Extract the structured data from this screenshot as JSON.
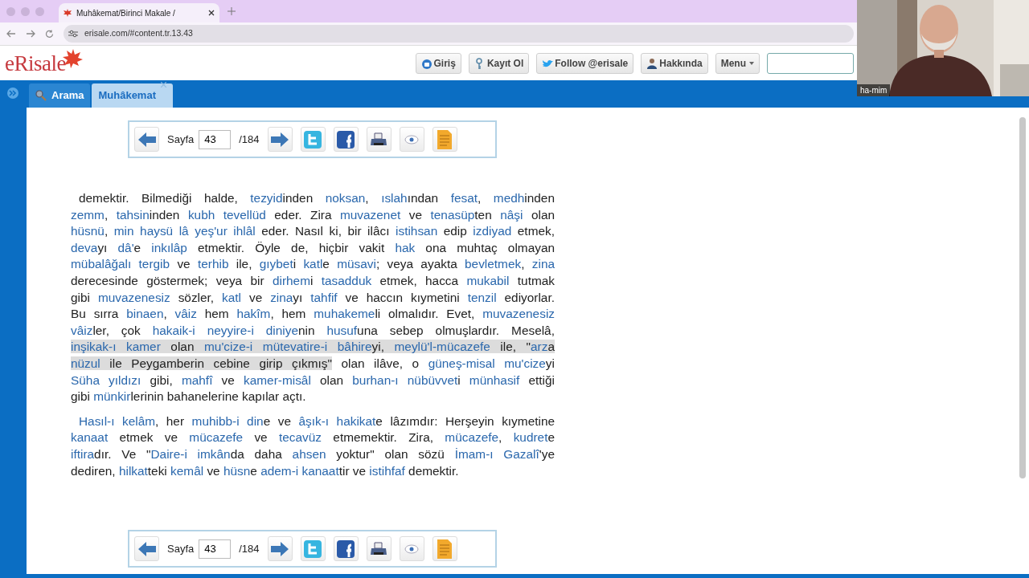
{
  "browser": {
    "tab_title": "Muhâkemat/Birinci Makale /",
    "url": "erisale.com/#content.tr.13.43"
  },
  "header": {
    "logo": "eRisale",
    "buttons": [
      {
        "label": "Giriş",
        "kind": "lock"
      },
      {
        "label": "Kayıt Ol",
        "kind": "key"
      },
      {
        "label": "Follow @erisale",
        "kind": "bird"
      },
      {
        "label": "Hakkında",
        "kind": "person"
      },
      {
        "label": "Menu",
        "kind": "menu"
      }
    ]
  },
  "tabs": [
    {
      "label": "Arama",
      "selected": false
    },
    {
      "label": "Muhâkemat",
      "selected": true
    }
  ],
  "pagers": [
    {
      "label": "Sayfa",
      "page": "43",
      "total": "/184"
    },
    {
      "label": "Sayfa",
      "page": "43",
      "total": "/184"
    }
  ],
  "paragraphs": [
    {
      "lines": [
        [
          {
            "text": "demektir. Bilmediği halde, ",
            "kind": "plain"
          },
          {
            "text": "tezyid",
            "kind": "link"
          },
          {
            "text": "inden ",
            "kind": "plain"
          },
          {
            "text": "noksan",
            "kind": "link"
          },
          {
            "text": ", ",
            "kind": "plain"
          },
          {
            "text": "ıslah",
            "kind": "link"
          },
          {
            "text": "ından ",
            "kind": "plain"
          },
          {
            "text": "fesat",
            "kind": "link"
          },
          {
            "text": ", ",
            "kind": "plain"
          },
          {
            "text": "medh",
            "kind": "link"
          },
          {
            "text": "inden",
            "kind": "plain"
          }
        ],
        [
          {
            "text": "zemm",
            "kind": "link"
          },
          {
            "text": ", ",
            "kind": "plain"
          },
          {
            "text": "tahsin",
            "kind": "link"
          },
          {
            "text": "inden ",
            "kind": "plain"
          },
          {
            "text": "kubh tevellüd",
            "kind": "link"
          },
          {
            "text": " eder. Zira ",
            "kind": "plain"
          },
          {
            "text": "muvazenet",
            "kind": "link"
          },
          {
            "text": " ve ",
            "kind": "plain"
          },
          {
            "text": "tenasüp",
            "kind": "link"
          },
          {
            "text": "ten ",
            "kind": "plain"
          },
          {
            "text": "nâşi",
            "kind": "link"
          },
          {
            "text": " olan",
            "kind": "plain"
          }
        ],
        [
          {
            "text": "hüsnü",
            "kind": "link"
          },
          {
            "text": ", ",
            "kind": "plain"
          },
          {
            "text": "min haysü lâ yeş'ur ihlâl",
            "kind": "link"
          },
          {
            "text": " eder. Nasıl ki, bir ilâcı ",
            "kind": "plain"
          },
          {
            "text": "istihsan",
            "kind": "link"
          },
          {
            "text": " edip ",
            "kind": "plain"
          },
          {
            "text": "izdiyad",
            "kind": "link"
          },
          {
            "text": " etmek,",
            "kind": "plain"
          }
        ],
        [
          {
            "text": "deva",
            "kind": "link"
          },
          {
            "text": "yı ",
            "kind": "plain"
          },
          {
            "text": "dâ'",
            "kind": "link"
          },
          {
            "text": "e ",
            "kind": "plain"
          },
          {
            "text": "inkılâp",
            "kind": "link"
          },
          {
            "text": " etmektir. Öyle de, hiçbir vakit ",
            "kind": "plain"
          },
          {
            "text": "hak",
            "kind": "link"
          },
          {
            "text": " ona muhtaç olmayan",
            "kind": "plain"
          }
        ],
        [
          {
            "text": "mübalâğalı tergib",
            "kind": "link"
          },
          {
            "text": " ve ",
            "kind": "plain"
          },
          {
            "text": "terhib",
            "kind": "link"
          },
          {
            "text": " ile, ",
            "kind": "plain"
          },
          {
            "text": "gıybet",
            "kind": "link"
          },
          {
            "text": "i ",
            "kind": "plain"
          },
          {
            "text": "katl",
            "kind": "link"
          },
          {
            "text": "e ",
            "kind": "plain"
          },
          {
            "text": "müsavi",
            "kind": "link"
          },
          {
            "text": "; veya ayakta ",
            "kind": "plain"
          },
          {
            "text": "bevletmek",
            "kind": "link"
          },
          {
            "text": ", ",
            "kind": "plain"
          },
          {
            "text": "zina",
            "kind": "link"
          }
        ],
        [
          {
            "text": "derecesinde göstermek; veya bir ",
            "kind": "plain"
          },
          {
            "text": "dirhem",
            "kind": "link"
          },
          {
            "text": "i ",
            "kind": "plain"
          },
          {
            "text": "tasadduk",
            "kind": "link"
          },
          {
            "text": " etmek, hacca ",
            "kind": "plain"
          },
          {
            "text": "mukabil",
            "kind": "link"
          },
          {
            "text": " tutmak",
            "kind": "plain"
          }
        ],
        [
          {
            "text": "gibi ",
            "kind": "plain"
          },
          {
            "text": "muvazenesiz",
            "kind": "link"
          },
          {
            "text": " sözler, ",
            "kind": "plain"
          },
          {
            "text": "katl",
            "kind": "link"
          },
          {
            "text": " ve ",
            "kind": "plain"
          },
          {
            "text": "zina",
            "kind": "link"
          },
          {
            "text": "yı ",
            "kind": "plain"
          },
          {
            "text": "tahfif",
            "kind": "link"
          },
          {
            "text": " ve haccın kıymetini ",
            "kind": "plain"
          },
          {
            "text": "tenzil",
            "kind": "link"
          },
          {
            "text": " ediyorlar.",
            "kind": "plain"
          }
        ],
        [
          {
            "text": "Bu sırra ",
            "kind": "plain"
          },
          {
            "text": "binaen",
            "kind": "link"
          },
          {
            "text": ", ",
            "kind": "plain"
          },
          {
            "text": "vâiz",
            "kind": "link"
          },
          {
            "text": " hem ",
            "kind": "plain"
          },
          {
            "text": "hakîm",
            "kind": "link"
          },
          {
            "text": ", hem ",
            "kind": "plain"
          },
          {
            "text": "muhakeme",
            "kind": "link"
          },
          {
            "text": "li olmalıdır. Evet, ",
            "kind": "plain"
          },
          {
            "text": "muvazenesiz",
            "kind": "link"
          }
        ],
        [
          {
            "text": "vâiz",
            "kind": "link"
          },
          {
            "text": "ler, çok ",
            "kind": "plain"
          },
          {
            "text": "hakaik-i neyyire-i diniye",
            "kind": "link"
          },
          {
            "text": "nin ",
            "kind": "plain"
          },
          {
            "text": "husuf",
            "kind": "link"
          },
          {
            "text": "una sebep olmuşlardır. Meselâ,",
            "kind": "plain"
          }
        ],
        [
          {
            "text": "inşikak-ı kamer",
            "kind": "link",
            "highlighted": true
          },
          {
            "text": " olan ",
            "kind": "plain",
            "highlighted": true
          },
          {
            "text": "mu'cize-i mütevatire-i bâhire",
            "kind": "link",
            "highlighted": true
          },
          {
            "text": "yi, ",
            "kind": "plain",
            "highlighted": true
          },
          {
            "text": "meylü'l-mücazefe",
            "kind": "link",
            "highlighted": true
          },
          {
            "text": " ile, \"",
            "kind": "plain",
            "highlighted": true
          },
          {
            "text": "arz",
            "kind": "link",
            "highlighted": true
          },
          {
            "text": "a",
            "kind": "plain",
            "highlighted": true
          }
        ],
        [
          {
            "text": "nüzul",
            "kind": "link",
            "highlighted": true
          },
          {
            "text": " ile Peygamberin cebine girip çıkmış\"",
            "kind": "plain",
            "highlighted": true
          },
          {
            "text": " olan ilâve, o ",
            "kind": "plain",
            "highlighted": false
          },
          {
            "text": "güneş-misal mu'cize",
            "kind": "link",
            "highlighted": false
          },
          {
            "text": "yi",
            "kind": "plain",
            "highlighted": false
          }
        ],
        [
          {
            "text": "Süha yıldızı",
            "kind": "link"
          },
          {
            "text": " gibi, ",
            "kind": "plain"
          },
          {
            "text": "mahfî",
            "kind": "link"
          },
          {
            "text": " ve ",
            "kind": "plain"
          },
          {
            "text": "kamer-misâl",
            "kind": "link"
          },
          {
            "text": " olan ",
            "kind": "plain"
          },
          {
            "text": "burhan-ı nübüvvet",
            "kind": "link"
          },
          {
            "text": "i ",
            "kind": "plain"
          },
          {
            "text": "münhasif",
            "kind": "link"
          },
          {
            "text": " ettiği",
            "kind": "plain"
          }
        ],
        [
          {
            "text": "gibi ",
            "kind": "plain"
          },
          {
            "text": "münkir",
            "kind": "link"
          },
          {
            "text": "lerinin bahanelerine kapılar açtı.",
            "kind": "plain"
          }
        ]
      ]
    },
    {
      "lines": [
        [
          {
            "text": "Hasıl-ı kelâm",
            "kind": "link"
          },
          {
            "text": ", her ",
            "kind": "plain"
          },
          {
            "text": "muhibb-i din",
            "kind": "link"
          },
          {
            "text": "e ve ",
            "kind": "plain"
          },
          {
            "text": "âşık-ı hakikat",
            "kind": "link"
          },
          {
            "text": "e lâzımdır: Herşeyin kıymetine",
            "kind": "plain"
          }
        ],
        [
          {
            "text": "kanaat",
            "kind": "link"
          },
          {
            "text": " etmek ve ",
            "kind": "plain"
          },
          {
            "text": "mücazefe",
            "kind": "link"
          },
          {
            "text": " ve ",
            "kind": "plain"
          },
          {
            "text": "tecavüz",
            "kind": "link"
          },
          {
            "text": " etmemektir. Zira, ",
            "kind": "plain"
          },
          {
            "text": "mücazefe",
            "kind": "link"
          },
          {
            "text": ", ",
            "kind": "plain"
          },
          {
            "text": "kudret",
            "kind": "link"
          },
          {
            "text": "e",
            "kind": "plain"
          }
        ],
        [
          {
            "text": "iftira",
            "kind": "link"
          },
          {
            "text": "dır. Ve \"",
            "kind": "plain"
          },
          {
            "text": "Daire-i imkân",
            "kind": "link"
          },
          {
            "text": "da daha ",
            "kind": "plain"
          },
          {
            "text": "ahsen",
            "kind": "link"
          },
          {
            "text": " yoktur\" olan sözü ",
            "kind": "plain"
          },
          {
            "text": "İmam-ı Gazalî",
            "kind": "link"
          },
          {
            "text": "'ye",
            "kind": "plain"
          }
        ],
        [
          {
            "text": "dediren, ",
            "kind": "plain"
          },
          {
            "text": "hilkat",
            "kind": "link"
          },
          {
            "text": "teki ",
            "kind": "plain"
          },
          {
            "text": "kemâl",
            "kind": "link"
          },
          {
            "text": " ve ",
            "kind": "plain"
          },
          {
            "text": "hüsn",
            "kind": "link"
          },
          {
            "text": "e ",
            "kind": "plain"
          },
          {
            "text": "adem-i kanaat",
            "kind": "link"
          },
          {
            "text": "tir ve ",
            "kind": "plain"
          },
          {
            "text": "istihfaf",
            "kind": "link"
          },
          {
            "text": " demektir.",
            "kind": "plain"
          }
        ]
      ]
    }
  ],
  "video_overlay": {
    "name": "ha-mim"
  }
}
